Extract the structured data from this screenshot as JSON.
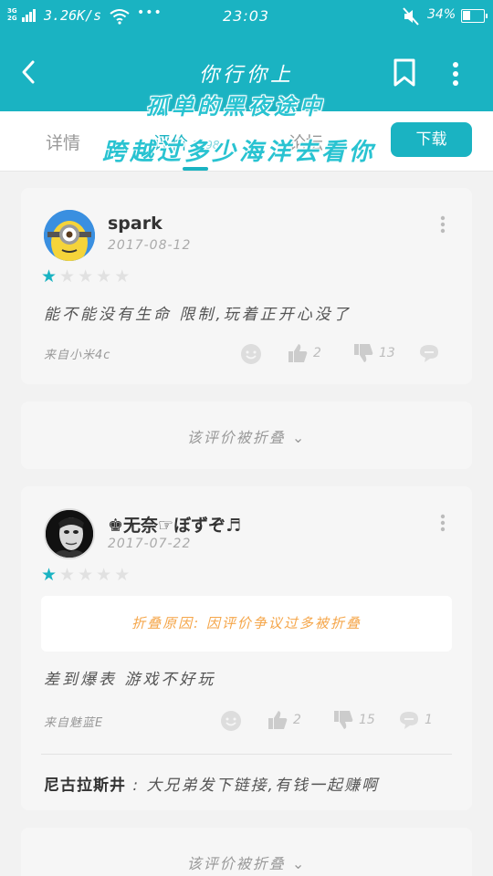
{
  "status_bar": {
    "network": "3G\n2G",
    "speed": "3.26K/s",
    "dots": "•••",
    "time": "23:03",
    "battery": "34%"
  },
  "app_bar": {
    "title": "你行你上"
  },
  "tabs": [
    {
      "label": "详情",
      "count": ""
    },
    {
      "label": "评价",
      "count": "1798"
    },
    {
      "label": "论坛",
      "count": "357"
    }
  ],
  "download_label": "下载",
  "overlay": {
    "line1": "孤单的黑夜途中",
    "line2": "跨越过多少海洋去看你"
  },
  "reviews": [
    {
      "username": "spark",
      "date": "2017-08-12",
      "rating": 1,
      "comment": "能不能没有生命 限制,玩着正开心没了",
      "source": "来自小米4c",
      "likes": "2",
      "dislikes": "13",
      "replies": ""
    },
    {
      "username": "♚无奈☞ぼずぞ♬",
      "date": "2017-07-22",
      "rating": 1,
      "fold_reason": "折叠原因: 因评价争议过多被折叠",
      "comment": "差到爆表 游戏不好玩",
      "source": "来自魅蓝E",
      "likes": "2",
      "dislikes": "15",
      "replies": "1",
      "reply_author": "尼古拉斯井",
      "reply_text": " : 大兄弟发下链接,有钱一起赚啊"
    }
  ],
  "folded_label": "该评价被折叠 ⌄",
  "colors": {
    "accent": "#1ab3c2",
    "fold_reason": "#f5a64a"
  }
}
